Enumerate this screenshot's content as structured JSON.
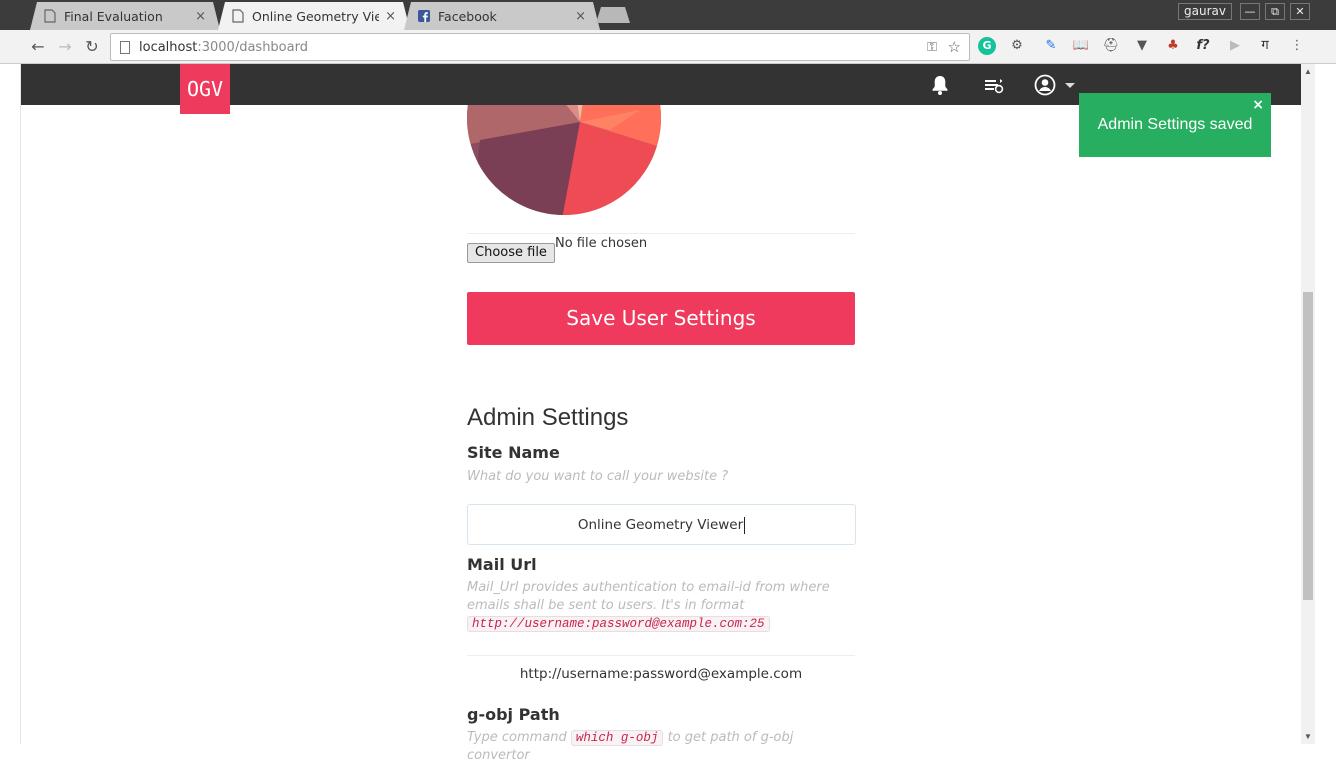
{
  "browser": {
    "tabs": [
      {
        "title": "Final Evaluation",
        "close": "×"
      },
      {
        "title": "Online Geometry Viewer",
        "close": "×"
      },
      {
        "title": "Facebook",
        "close": "×"
      }
    ],
    "user": "gaurav",
    "window_buttons": {
      "minimize": "—",
      "restore": "⧉",
      "close": "✕"
    },
    "url_host": "localhost",
    "url_rest": ":3000/dashboard",
    "nav": {
      "back": "←",
      "forward": "→",
      "reload": "↻"
    },
    "extensions": [
      "G",
      "⚙",
      "✎",
      "📖",
      "⛑",
      "▼",
      "♣",
      "f?",
      "▶",
      "ग",
      "⋮"
    ]
  },
  "app": {
    "logo": "OGV",
    "toast": {
      "message": "Admin Settings saved",
      "close": "×"
    }
  },
  "user_settings": {
    "file_button": "Choose file",
    "file_status": "No file chosen",
    "save_button": "Save User Settings"
  },
  "admin": {
    "title": "Admin Settings",
    "site_name": {
      "label": "Site Name",
      "help": "What do you want to call your website ?",
      "value": "Online Geometry Viewer"
    },
    "mail_url": {
      "label": "Mail Url",
      "help": "Mail_Url provides authentication to email-id from where emails shall be sent to users. It's in format",
      "format_code": "http://username:password@example.com:25",
      "value": "http://username:password@example.com"
    },
    "gobj_path": {
      "label": "g-obj Path",
      "help_before": "Type command",
      "help_code": "which g-obj",
      "help_after": "to get path of g-obj convertor"
    }
  },
  "colors": {
    "accent": "#ef3a5d",
    "appbar": "#333333",
    "toast": "#27ae60"
  }
}
